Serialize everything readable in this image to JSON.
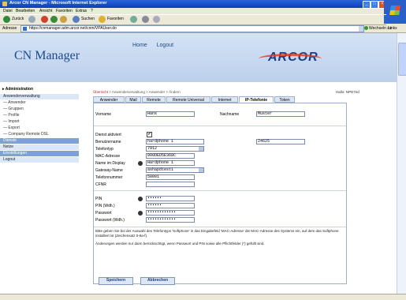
{
  "window": {
    "title": "Arcor CN Manager - Microsoft Internet Explorer"
  },
  "menu": [
    "Datei",
    "Bearbeiten",
    "Ansicht",
    "Favoriten",
    "Extras",
    "?"
  ],
  "toolbar": {
    "back": "Zurück",
    "search": "Suchen",
    "favorites": "Favoriten"
  },
  "address": {
    "label": "Adresse",
    "url": "https://cnmanager.adm.arcor.net/cnm/VPAUser.do",
    "go": "Wechseln zu",
    "links": "Links"
  },
  "header": {
    "logo": "CN Manager",
    "links": [
      "Home",
      "Logout"
    ],
    "brand": "ARCOR"
  },
  "sidebar": {
    "heading": "Administration",
    "items": [
      {
        "label": "Anwenderverwaltung",
        "style": "light"
      },
      {
        "label": "— Anwender",
        "style": "sub"
      },
      {
        "label": "— Gruppen",
        "style": "sub"
      },
      {
        "label": "— Profile",
        "style": "sub"
      },
      {
        "label": "— Import",
        "style": "sub"
      },
      {
        "label": "— Export",
        "style": "sub"
      },
      {
        "label": "— Company Remote DSL",
        "style": "sub"
      },
      {
        "label": "Dienste",
        "style": "blue"
      },
      {
        "label": "Netze",
        "style": "light"
      },
      {
        "label": "Einstellungen",
        "style": "blue"
      },
      {
        "label": "Logout",
        "style": "light"
      }
    ]
  },
  "breadcrumb": {
    "first": "Übersicht",
    "rest": " > Anwenderverwaltung > Anwender > Ändern"
  },
  "user": "Hallo: NPD7ed",
  "tabs": [
    "Anwender",
    "Mail",
    "Remote",
    "Remote Universal",
    "Internet",
    "IP-Telefonie",
    "Token"
  ],
  "form": {
    "vorname_label": "Vorname",
    "vorname": "Hans",
    "nachname_label": "Nachname",
    "nachname": "Muster",
    "dienst_label": "Dienst aktiviert",
    "dienst_checked": "✔",
    "benutzer_label": "Benutzername",
    "benutzer": "hardphone 1",
    "benutzer_ext": "24625",
    "telefontyp_label": "Telefontyp",
    "telefontyp": "7912",
    "mac_label": "MAC-Adresse",
    "mac": "000DED5E368C",
    "display_label": "Name im Display",
    "display": "Hardphone 1",
    "gateway_label": "Gateway-Name",
    "gateway": "ashapdtest1",
    "telnr_label": "Telefonnummer",
    "telnr": "58001",
    "cfnr_label": "CFNR",
    "cfnr": "",
    "pin_label": "PIN",
    "pin": "••••••",
    "pinw_label": "PIN (Wdh.)",
    "pinw": "••••••",
    "pw_label": "Passwort",
    "pw": "••••••••••••",
    "pww_label": "Passwort (Wdh.)",
    "pww": "••••••••••••"
  },
  "notes": {
    "n1": "Bitte geben Sie bei der Auswahl des Telefontyps 'Softphone' in das Eingabefeld 'MAC-Adresse' die MAC-Adresse des Systems ein, auf dem das Softphone installiert ist (Zeichensatz 0-9a-f).",
    "n2": "Änderungen werden nur dann berücksichtigt, wenn Passwort und PIN sowie alle Pflichtfelder (*) gefüllt sind."
  },
  "buttons": {
    "save": "Speichern",
    "cancel": "Abbrechen"
  }
}
